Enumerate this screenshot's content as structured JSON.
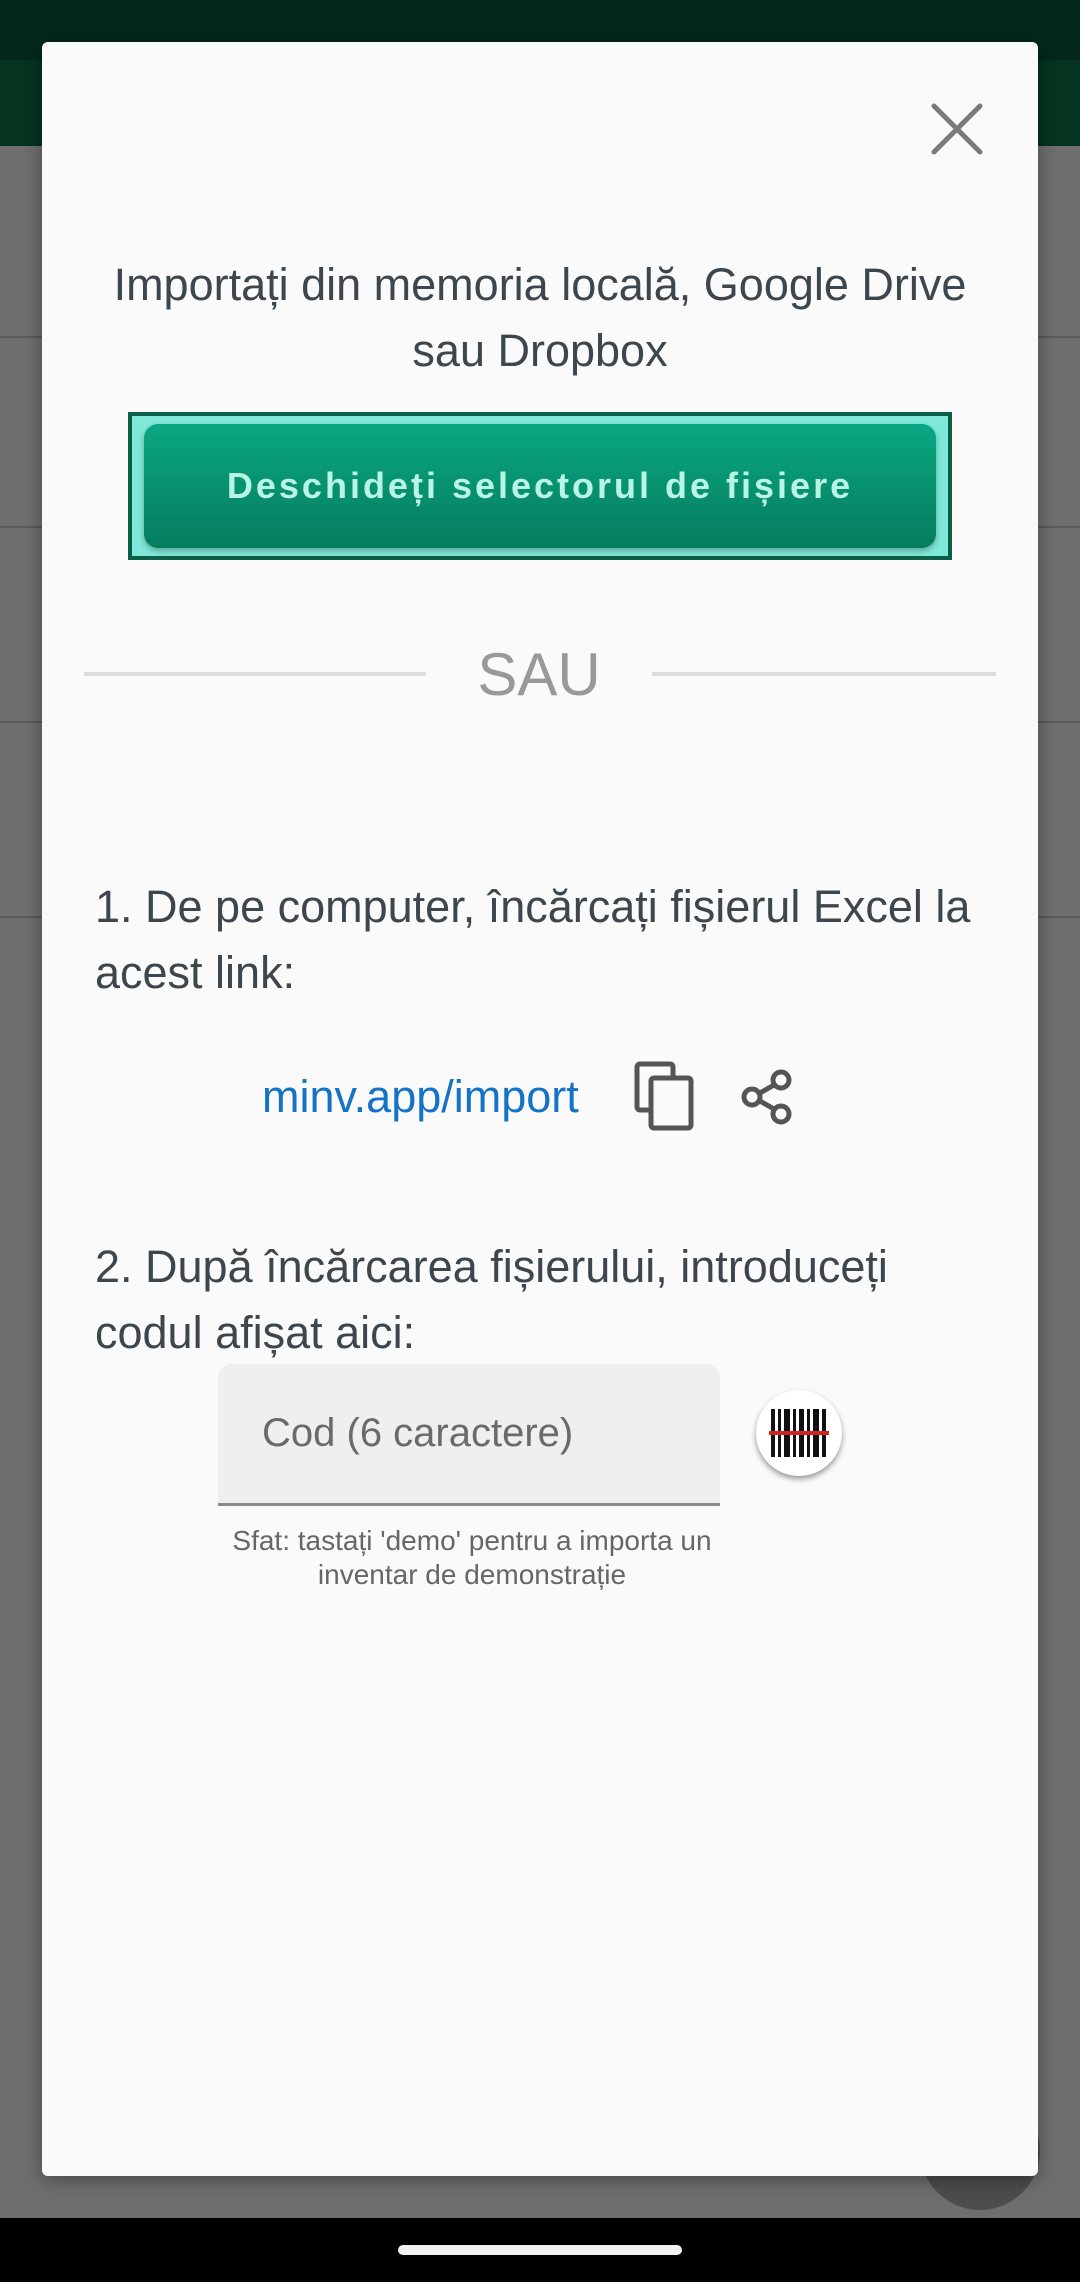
{
  "dialog": {
    "close_icon": "close-icon",
    "headline": "Importați din memoria locală, Google Drive sau Dropbox",
    "open_picker_label": "Deschideți selectorul de fișiere",
    "or_label": "SAU",
    "step1_text": "1. De pe computer, încărcați fișierul Excel la acest link:",
    "link_text": "minv.app/import",
    "copy_icon": "copy-icon",
    "share_icon": "share-icon",
    "step2_text": "2. După încărcarea fișierului, introduceți codul afișat aici:",
    "code_field": {
      "placeholder": "Cod (6 caractere)",
      "value": ""
    },
    "scan_icon": "barcode-scan-icon",
    "hint": "Sfat: tastați 'demo' pentru a importa un inventar de demonstrație"
  },
  "colors": {
    "app_bar": "#04331f",
    "primary_button": "#067c5e",
    "button_focus_ring": "#7fe8d8",
    "link": "#1473c6",
    "dialog_bg": "#fafafa"
  }
}
